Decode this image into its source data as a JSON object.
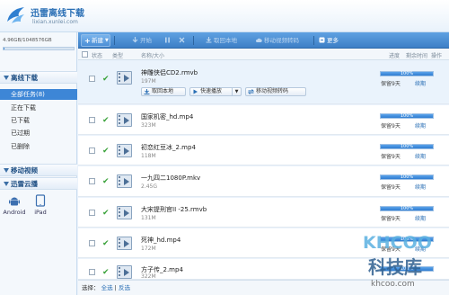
{
  "app": {
    "title": "迅雷离线下载",
    "url": "lixian.xunlei.com"
  },
  "sidebar": {
    "quota_text": "4.96GB/1048576GB",
    "quota_fraction": 0.0,
    "offline_heading": "离线下载",
    "items": [
      {
        "label": "全部任务(8)",
        "active": true
      },
      {
        "label": "正在下载",
        "active": false
      },
      {
        "label": "已下载",
        "active": false
      },
      {
        "label": "已过期",
        "active": false
      },
      {
        "label": "已删除",
        "active": false
      }
    ],
    "mobile_heading": "移动视频",
    "cloud_heading": "迅雷云播",
    "devices": [
      "Android",
      "iPad"
    ]
  },
  "toolbar": {
    "new_label": "新建",
    "start_label": "开始",
    "pause_label": "",
    "delete_label": "",
    "fetch_local_label": "取回本地",
    "transcode_label": "移动视频转码",
    "more_label": "更多"
  },
  "columns": {
    "status": "状态",
    "type": "类型",
    "name_size": "名称/大小",
    "progress": "进度",
    "remaining": "剩余时间",
    "action": "操作"
  },
  "row_actions": {
    "fetch_local": "取回本地",
    "quick_play": "快速播放",
    "transcode": "移动视频转码"
  },
  "tasks": [
    {
      "name": "神雕侠侣CD2.rmvb",
      "size": "197M",
      "progress": "100%",
      "progress_value": 100,
      "keep": "保留9天",
      "renew": "续期"
    },
    {
      "name": "国家机密_hd.mp4",
      "size": "323M",
      "progress": "100%",
      "progress_value": 100,
      "keep": "保留9天",
      "renew": "续期"
    },
    {
      "name": "初恋红豆冰_2.mp4",
      "size": "118M",
      "progress": "100%",
      "progress_value": 100,
      "keep": "保留9天",
      "renew": "续期"
    },
    {
      "name": "一九四二1080P.mkv",
      "size": "2.45G",
      "progress": "100%",
      "progress_value": 100,
      "keep": "保留9天",
      "renew": "续期"
    },
    {
      "name": "大宋提刑官II -25.rmvb",
      "size": "131M",
      "progress": "100%",
      "progress_value": 100,
      "keep": "保留9天",
      "renew": "续期"
    },
    {
      "name": "死神_hd.mp4",
      "size": "172M",
      "progress": "100%",
      "progress_value": 100,
      "keep": "保留9天",
      "renew": "续期"
    },
    {
      "name": "方子传_2.mp4",
      "size": "322M",
      "progress": "100%",
      "progress_value": 100,
      "keep": "保留9天",
      "renew": "续期"
    }
  ],
  "footer": {
    "select_label": "选择：",
    "select_all": "全选",
    "separator": "|",
    "invert": "反选"
  },
  "watermark": {
    "brand": "KHCOO",
    "cn": "科技库",
    "domain": "khcoo.com"
  },
  "colors": {
    "toolbar": "#3d7fc6",
    "accent": "#2a6fb5",
    "progress": "#2f7cd0",
    "check": "#3aa23a",
    "watermark": "#5ab0e0"
  }
}
